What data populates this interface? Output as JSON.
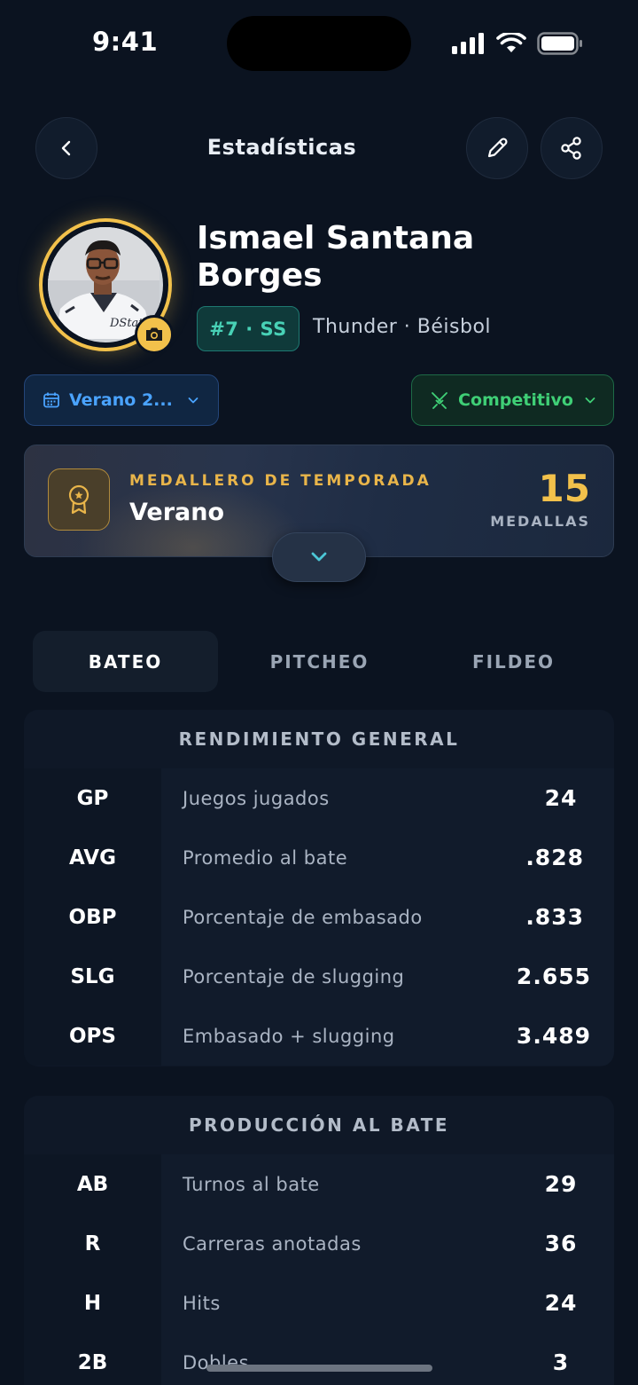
{
  "status_bar": {
    "time": "9:41"
  },
  "header": {
    "title": "Estadísticas"
  },
  "profile": {
    "name_line1": "Ismael Santana",
    "name_line2": "Borges",
    "number_position": "#7 · SS",
    "team_sport": "Thunder · Béisbol",
    "jersey_text": "DStats"
  },
  "filters": {
    "season_label": "Verano 2...",
    "mode_label": "Competitivo"
  },
  "medal_card": {
    "kicker": "MEDALLERO DE TEMPORADA",
    "season": "Verano",
    "count": "15",
    "unit": "MEDALLAS"
  },
  "tabs": [
    {
      "label": "BATEO",
      "active": true
    },
    {
      "label": "PITCHEO",
      "active": false
    },
    {
      "label": "FILDEO",
      "active": false
    }
  ],
  "sections": [
    {
      "title": "RENDIMIENTO GENERAL",
      "rows": [
        {
          "abbr": "GP",
          "desc": "Juegos jugados",
          "value": "24"
        },
        {
          "abbr": "AVG",
          "desc": "Promedio al bate",
          "value": ".828"
        },
        {
          "abbr": "OBP",
          "desc": "Porcentaje de embasado",
          "value": ".833"
        },
        {
          "abbr": "SLG",
          "desc": "Porcentaje de slugging",
          "value": "2.655"
        },
        {
          "abbr": "OPS",
          "desc": "Embasado + slugging",
          "value": "3.489"
        }
      ]
    },
    {
      "title": "PRODUCCIÓN AL BATE",
      "rows": [
        {
          "abbr": "AB",
          "desc": "Turnos al bate",
          "value": "29"
        },
        {
          "abbr": "R",
          "desc": "Carreras anotadas",
          "value": "36"
        },
        {
          "abbr": "H",
          "desc": "Hits",
          "value": "24"
        },
        {
          "abbr": "2B",
          "desc": "Dobles",
          "value": "3"
        }
      ]
    }
  ],
  "colors": {
    "background": "#0b1320",
    "gold": "#f2c14b",
    "teal": "#48d1b6",
    "blue": "#4aa3ff",
    "green": "#3fcf76"
  }
}
